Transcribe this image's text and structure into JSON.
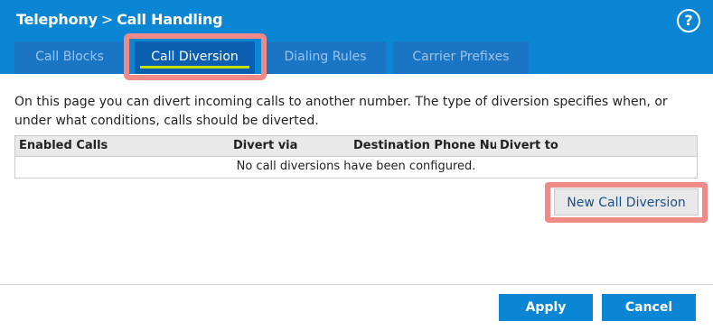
{
  "header": {
    "breadcrumb": {
      "parent": "Telephony",
      "separator": ">",
      "current": "Call Handling"
    },
    "help_label": "?"
  },
  "tabs": [
    {
      "label": "Call Blocks",
      "active": false
    },
    {
      "label": "Call Diversion",
      "active": true
    },
    {
      "label": "Dialing Rules",
      "active": false
    },
    {
      "label": "Carrier Prefixes",
      "active": false
    }
  ],
  "description": "On this page you can divert incoming calls to another number. The type of diversion specifies when, or under what conditions, calls should be diverted.",
  "table": {
    "columns": [
      "Enabled Calls",
      "Divert via",
      "Destination Phone Number",
      "Divert to"
    ],
    "empty_message": "No call diversions have been configured."
  },
  "new_button_label": "New Call Diversion",
  "footer": {
    "apply_label": "Apply",
    "cancel_label": "Cancel"
  },
  "colors": {
    "header_blue": "#0a86d4",
    "active_tab": "#0a5fb0",
    "tab_underline": "#c8e000",
    "highlight": "#f08a86"
  }
}
